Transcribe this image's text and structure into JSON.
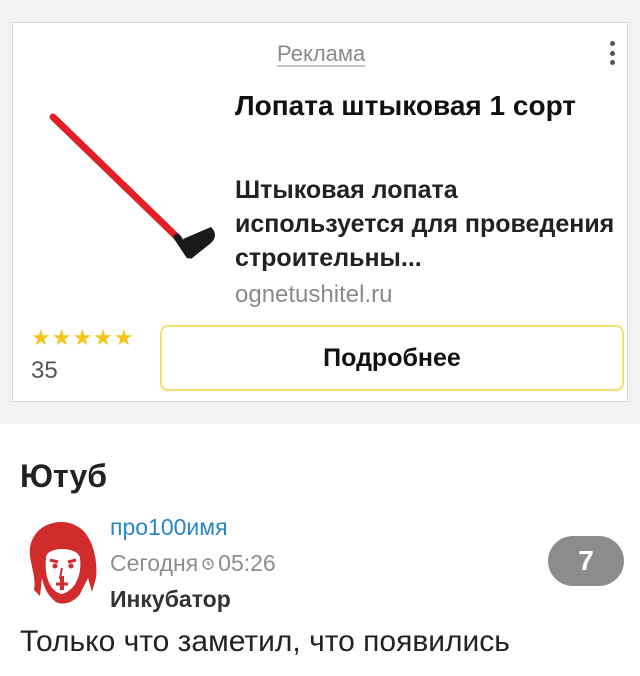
{
  "ad": {
    "label": "Реклама",
    "image_alt": "red-shovel",
    "title": "Лопата штыковая 1 сорт",
    "description": "Штыковая лопата используется для проведения строительны...",
    "domain": "ognetushitel.ru",
    "stars": "★★★★★",
    "rating_value": 5,
    "rating_count": "35",
    "button_label": "Подробнее",
    "menu_icon": "kebab-menu-icon"
  },
  "post": {
    "title": "Ютуб",
    "author": "про100имя",
    "date": "Сегодня",
    "time": "05:26",
    "community": "Инкубатор",
    "rating": "7",
    "text": "Только что заметил, что появились"
  },
  "colors": {
    "author_link": "#2a86c8",
    "star": "#f5c518",
    "button_border": "#f4df73",
    "badge": "#8c8c8c"
  }
}
